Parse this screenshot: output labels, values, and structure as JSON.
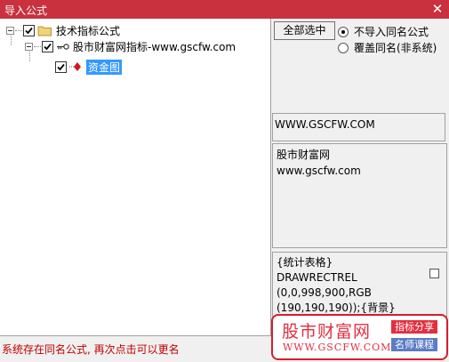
{
  "window": {
    "title": "导入公式",
    "close_glyph": "✕",
    "title_bar_color": "#c9313f"
  },
  "tree": {
    "root": {
      "label": "技术指标公式",
      "checked": true,
      "icon": "folder-icon"
    },
    "group": {
      "label": "股市财富网指标-www.gscfw.com",
      "checked": true,
      "icon": "key-icon"
    },
    "item": {
      "label": "资金图",
      "checked": true,
      "selected": true,
      "icon": "formula-diamond-icon"
    }
  },
  "options": {
    "select_all_label": "全部选中",
    "radio_skip_label": "不导入同名公式",
    "radio_overwrite_label": "覆盖同名(非系统)",
    "selected": "radio_skip"
  },
  "details": {
    "url": "WWW.GSCFW.COM",
    "description_lines": [
      "股市财富网",
      "www.gscfw.com"
    ],
    "code_lines": [
      "{统计表格}",
      "DRAWRECTREL",
      "(0,0,998,900,RGB",
      "(190,190,190));{背景}"
    ]
  },
  "status": {
    "message": "系统存在同名公式, 再次点击可以更名",
    "color": "#c00000"
  },
  "watermark": {
    "name": "股市财富网",
    "url": "WWW.GSCFW.COM",
    "tag_1": "指标分享",
    "tag_2": "名师课程",
    "brand_color": "#e23040"
  }
}
